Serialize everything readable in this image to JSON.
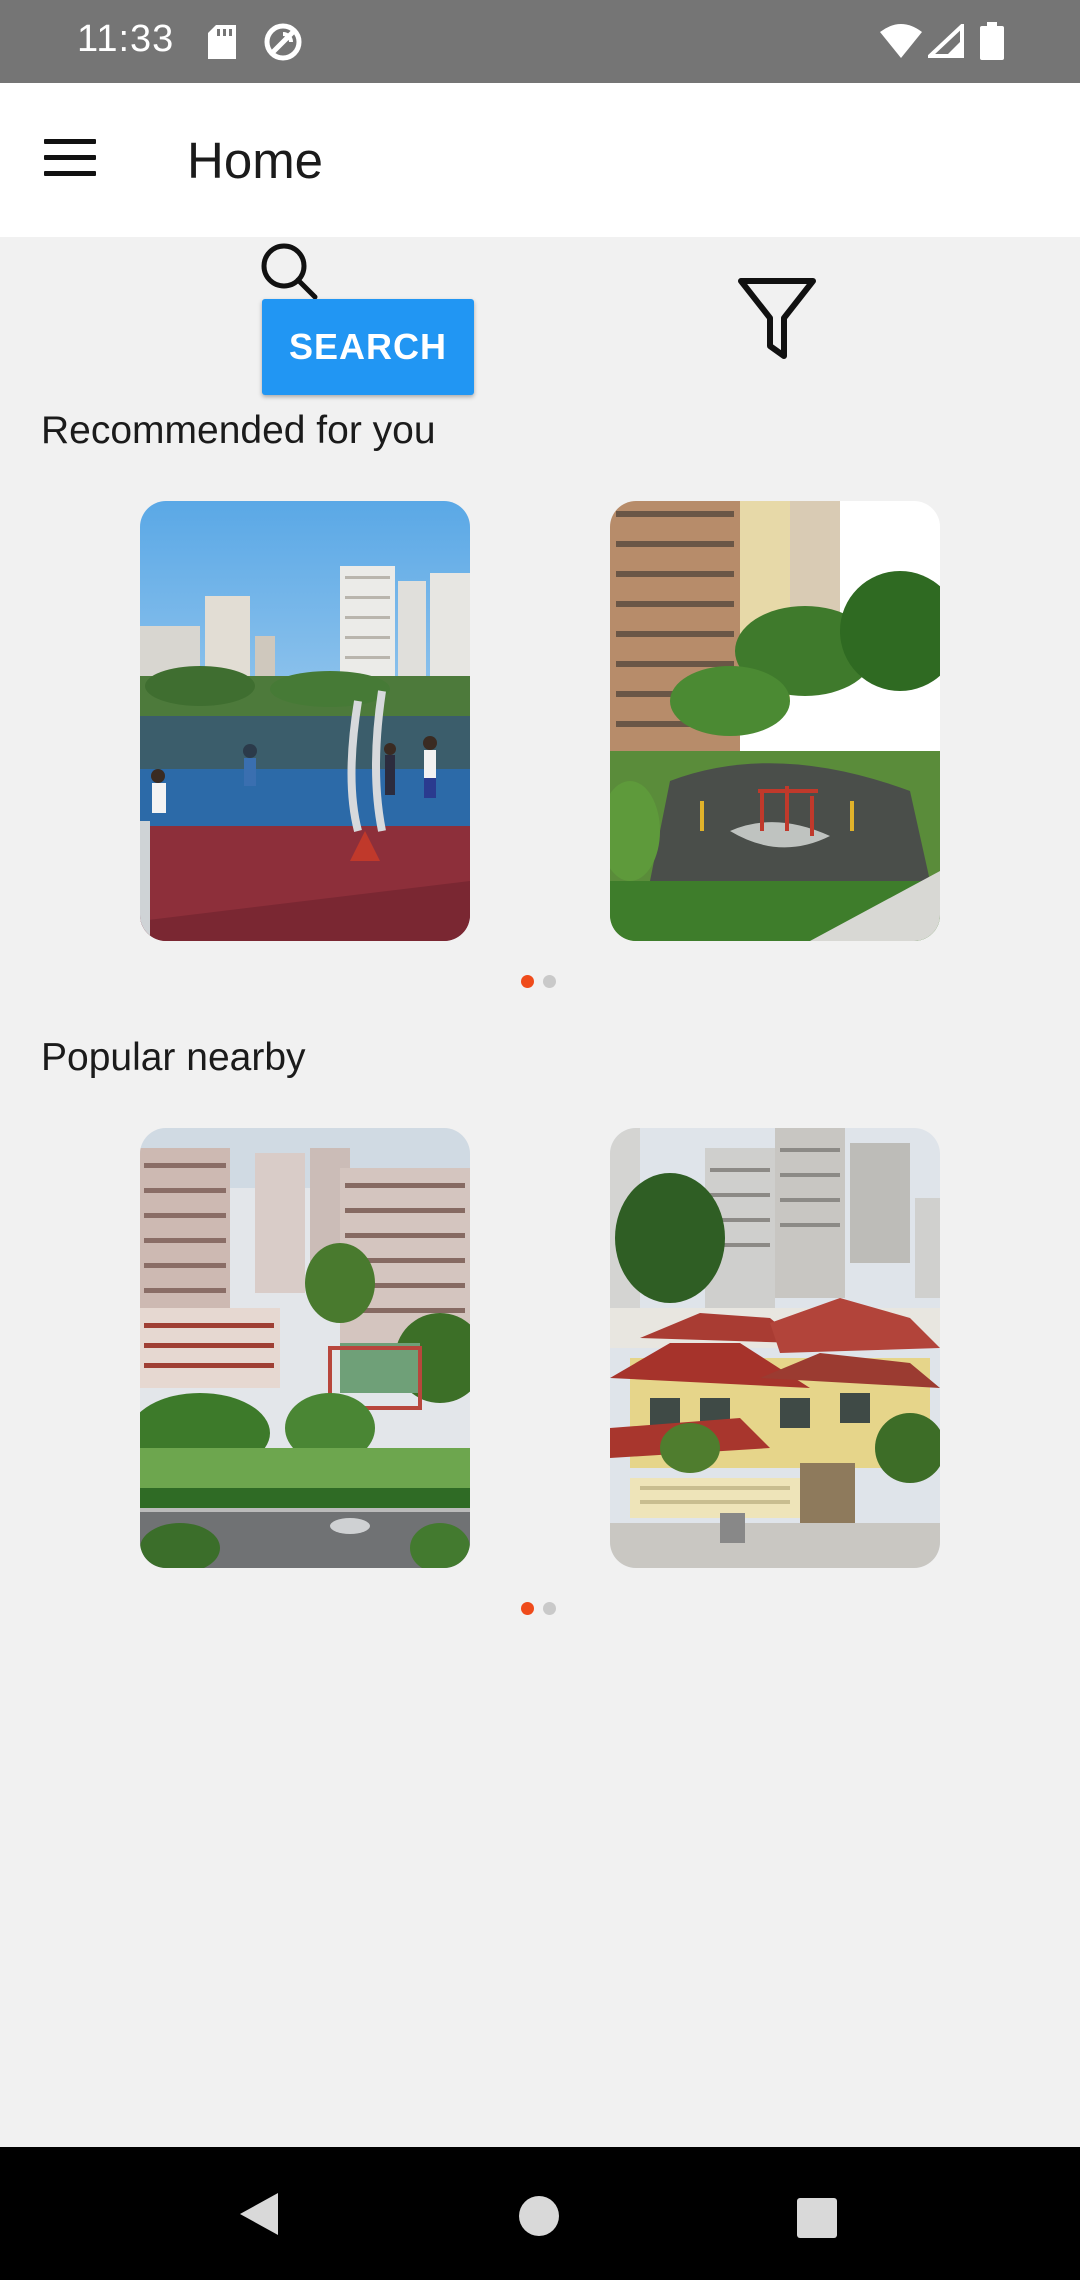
{
  "status_bar": {
    "time": "11:33",
    "icons": [
      "sd-card-icon",
      "sync-icon",
      "wifi-icon",
      "cell-signal-icon",
      "battery-icon"
    ]
  },
  "app_bar": {
    "title": "Home",
    "menu_icon": "hamburger-menu-icon"
  },
  "search": {
    "button_label": "SEARCH",
    "icon": "search-icon",
    "filter_icon": "filter-icon"
  },
  "sections": {
    "recommended": {
      "title": "Recommended for you",
      "cards": [
        {
          "image": "park-with-high-rise-buildings"
        },
        {
          "image": "residential-tower-with-playground"
        }
      ],
      "page_index": 0,
      "page_count": 2
    },
    "popular": {
      "title": "Popular nearby",
      "cards": [
        {
          "image": "condominium-blocks-with-tennis-court"
        },
        {
          "image": "terrace-houses-with-red-roofs"
        }
      ],
      "page_index": 0,
      "page_count": 2
    }
  },
  "colors": {
    "accent": "#2196f3",
    "indicator_active": "#ef4b1b",
    "indicator_inactive": "#c9c9c9",
    "background": "#f1f1f1"
  },
  "nav_bar": {
    "icons": [
      "back-icon",
      "home-icon",
      "recents-icon"
    ]
  }
}
